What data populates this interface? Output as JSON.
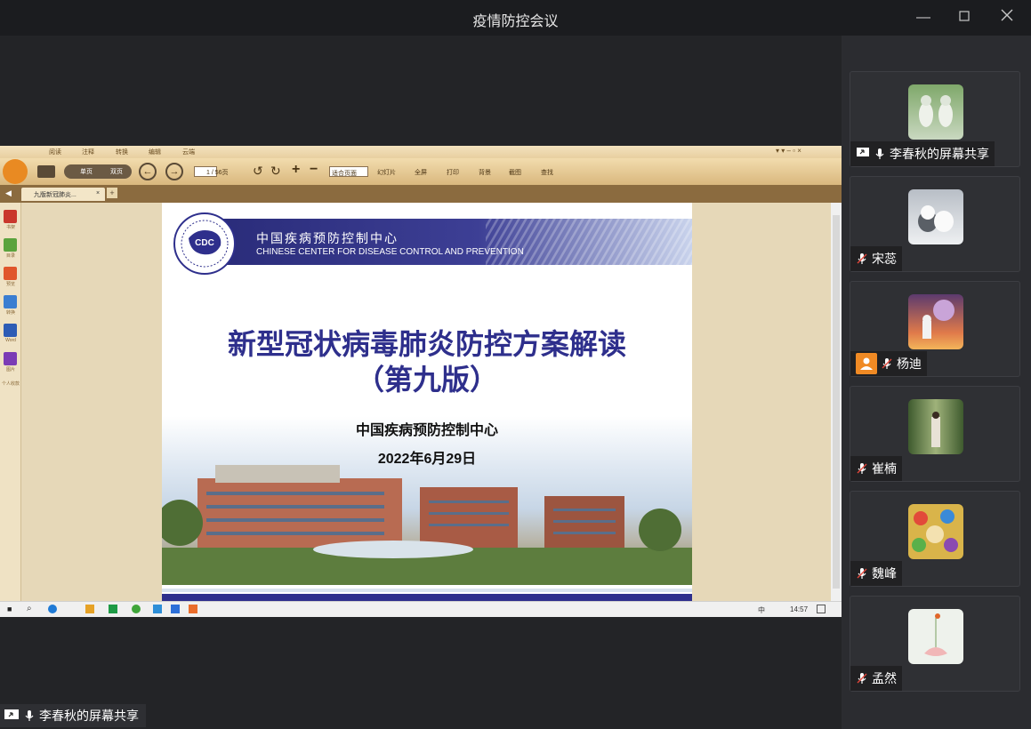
{
  "window": {
    "title": "疫情防控会议"
  },
  "share_label": "李春秋的屏幕共享",
  "participants": [
    {
      "name": "李春秋的屏幕共享",
      "avatar_icon": "figurines-avatar",
      "sharing": true
    },
    {
      "name": "宋蕊",
      "avatar_icon": "cats-avatar",
      "sharing": false
    },
    {
      "name": "杨迪",
      "avatar_icon": "astronaut-avatar",
      "host": true
    },
    {
      "name": "崔楠",
      "avatar_icon": "alley-avatar"
    },
    {
      "name": "魏峰",
      "avatar_icon": "cartoon-avatar"
    },
    {
      "name": "孟然",
      "avatar_icon": "lotus-avatar"
    }
  ],
  "reader": {
    "menu_tabs": [
      "阅读",
      "注释",
      "转换",
      "编辑",
      "云端"
    ],
    "toolbar": {
      "single_page": "单页",
      "double_page": "双页",
      "page_total": "1 / 56页",
      "zoom": "适合页面",
      "slideshow": "幻灯片",
      "fullscreen": "全屏",
      "print": "打印",
      "background": "背景",
      "screenshot": "截图",
      "search": "查找"
    },
    "tab_title": "九版新冠肺炎...",
    "side_items": [
      "书架",
      "目录",
      "预览",
      "转换",
      "Word",
      "图片",
      "个人收款"
    ]
  },
  "slide": {
    "org_cn": "中国疾病预防控制中心",
    "org_en": "CHINESE CENTER FOR DISEASE CONTROL AND PREVENTION",
    "logo_text": "CDC",
    "title_line1": "新型冠状病毒肺炎防控方案解读",
    "title_line2": "（第九版）",
    "presenter": "中国疾病预防控制中心",
    "date": "2022年6月29日"
  },
  "taskbar": {
    "clock": "14:57",
    "ime": "中"
  },
  "colors": {
    "accent_purple": "#2e2f8c",
    "namebar": "#1e1e21",
    "host_badge": "#f08a24"
  }
}
